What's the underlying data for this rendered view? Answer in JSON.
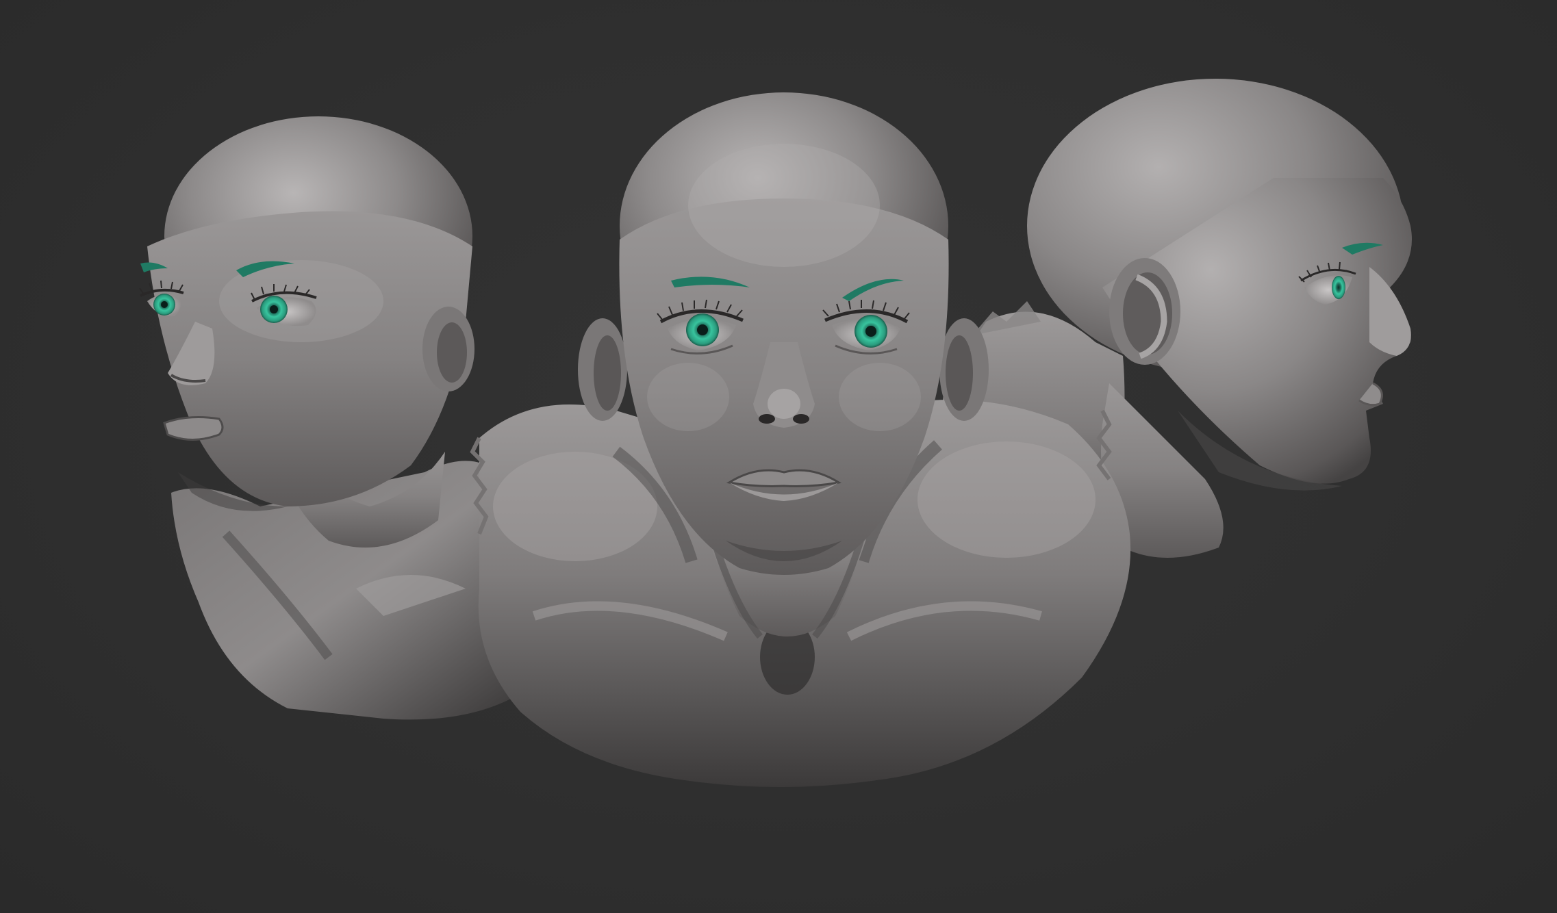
{
  "scene": {
    "background_color": "#2e2e2e",
    "clay_color": "#8a8787",
    "clay_highlight": "#b9b6b6",
    "clay_shadow": "#3a3838",
    "eye_color": "#2fae8c",
    "brow_color": "#1f7a63",
    "views": [
      "three-quarter-left",
      "front",
      "profile-right"
    ]
  }
}
